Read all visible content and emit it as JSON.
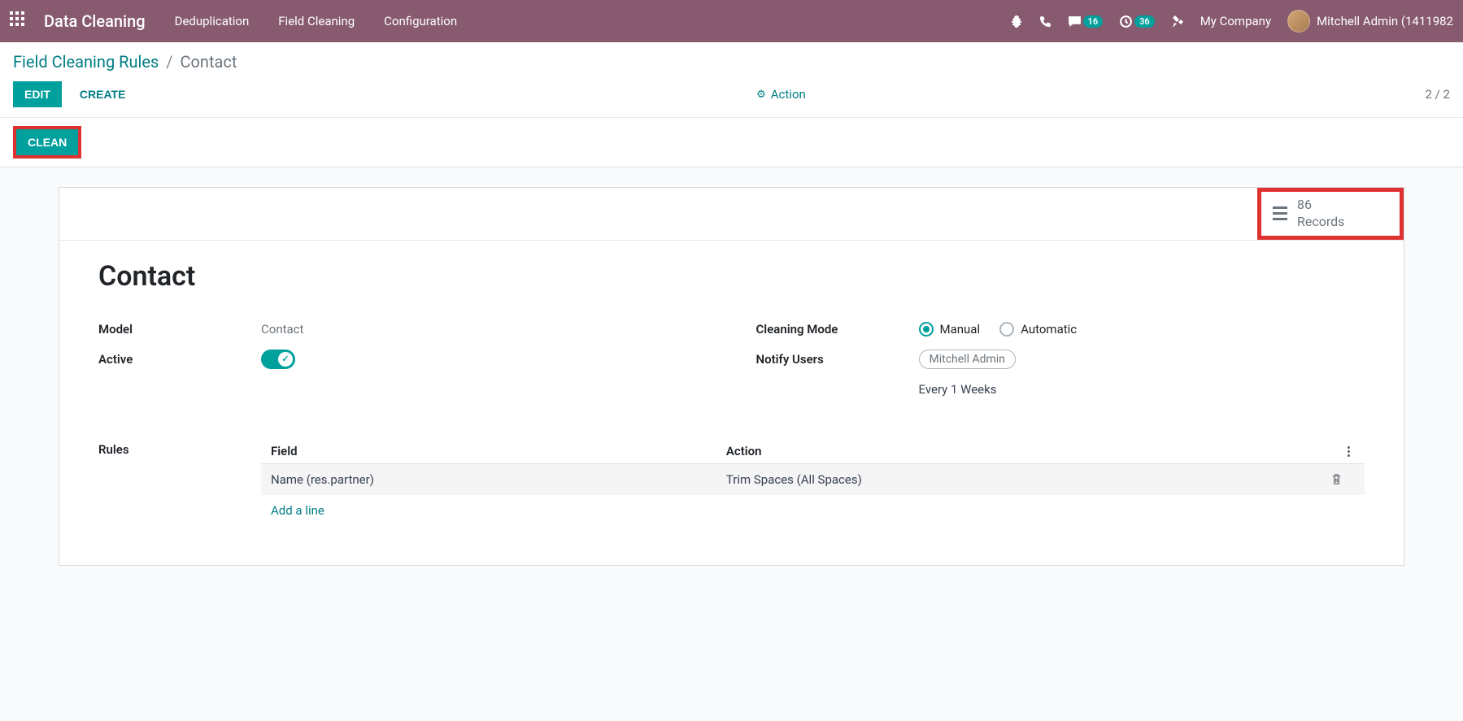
{
  "topbar": {
    "app_title": "Data Cleaning",
    "nav": [
      "Deduplication",
      "Field Cleaning",
      "Configuration"
    ],
    "badges": {
      "conversations": "16",
      "activities": "36"
    },
    "company": "My Company",
    "user": "Mitchell Admin (1411982"
  },
  "breadcrumb": {
    "parent": "Field Cleaning Rules",
    "current": "Contact"
  },
  "buttons": {
    "edit": "EDIT",
    "create": "CREATE",
    "action": "Action",
    "clean": "CLEAN"
  },
  "pager": "2 / 2",
  "stat": {
    "count": "86",
    "label": "Records"
  },
  "form": {
    "title": "Contact",
    "labels": {
      "model": "Model",
      "active": "Active",
      "cleaning_mode": "Cleaning Mode",
      "notify_users": "Notify Users",
      "rules": "Rules"
    },
    "model_value": "Contact",
    "cleaning_mode": {
      "manual": "Manual",
      "automatic": "Automatic"
    },
    "notify_user_tag": "Mitchell Admin",
    "notify_freq": "Every 1 Weeks"
  },
  "rules_table": {
    "headers": {
      "field": "Field",
      "action": "Action"
    },
    "row": {
      "field": "Name (res.partner)",
      "action": "Trim Spaces (All Spaces)"
    },
    "add_line": "Add a line"
  }
}
